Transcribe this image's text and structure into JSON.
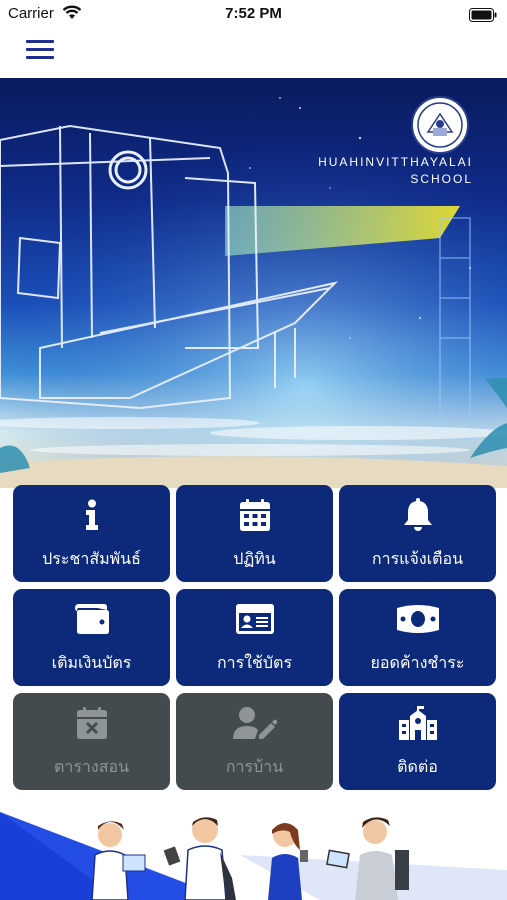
{
  "status_bar": {
    "carrier": "Carrier",
    "time": "7:52 PM",
    "icons": [
      "wifi-icon",
      "battery-icon"
    ]
  },
  "nav": {
    "menu_icon": "hamburger-menu-icon"
  },
  "hero": {
    "school_name_line1": "HUAHINVITTHAYALAI",
    "school_name_line2": "SCHOOL"
  },
  "menu": [
    {
      "label": "ประชาสัมพันธ์",
      "icon": "info-icon",
      "enabled": true
    },
    {
      "label": "ปฏิทิน",
      "icon": "calendar-icon",
      "enabled": true
    },
    {
      "label": "การแจ้งเตือน",
      "icon": "bell-icon",
      "enabled": true
    },
    {
      "label": "เติมเงินบัตร",
      "icon": "wallet-icon",
      "enabled": true
    },
    {
      "label": "การใช้บัตร",
      "icon": "id-card-icon",
      "enabled": true
    },
    {
      "label": "ยอดค้างชำระ",
      "icon": "money-bill-icon",
      "enabled": true
    },
    {
      "label": "ตารางสอน",
      "icon": "calendar-times-icon",
      "enabled": false
    },
    {
      "label": "การบ้าน",
      "icon": "user-edit-icon",
      "enabled": false
    },
    {
      "label": "ติดต่อ",
      "icon": "school-icon",
      "enabled": true
    }
  ],
  "colors": {
    "tile_active": "#0d2a7a",
    "tile_disabled": "#444b4f",
    "accent_navy": "#1b2f8e"
  }
}
